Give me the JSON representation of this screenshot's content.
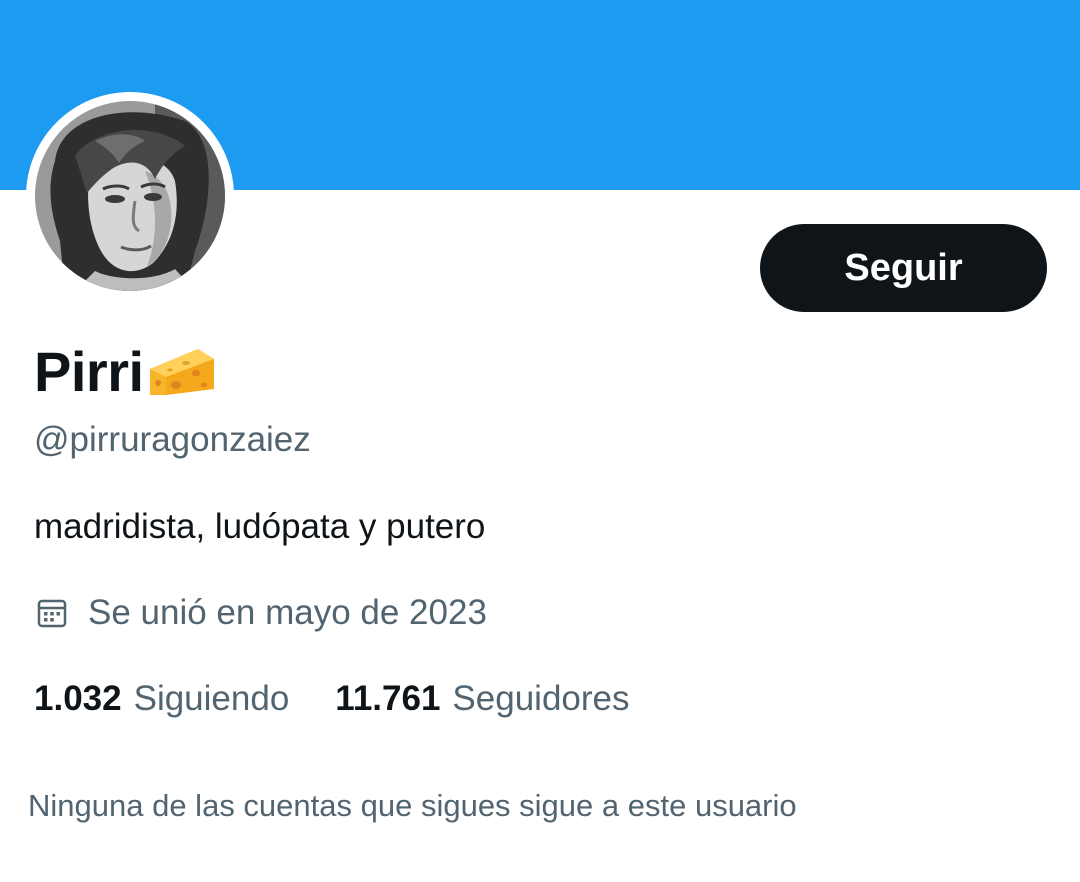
{
  "profile": {
    "display_name": "Pirri",
    "name_emoji": "cheese-icon",
    "handle": "@pirruragonzaiez",
    "bio": "madridista, ludópata y putero",
    "joined": "Se unió en mayo de 2023",
    "joined_icon": "calendar-icon",
    "avatar": "avatar-photo"
  },
  "actions": {
    "follow_label": "Seguir"
  },
  "stats": {
    "following_count": "1.032",
    "following_label": "Siguiendo",
    "followers_count": "11.761",
    "followers_label": "Seguidores"
  },
  "mutuals_text": "Ninguna de las cuentas que sigues sigue a este usuario",
  "colors": {
    "banner": "#1d9bf0",
    "primary_text": "#0f1419",
    "secondary_text": "#536471",
    "button_bg": "#0f1419",
    "button_text": "#ffffff"
  }
}
